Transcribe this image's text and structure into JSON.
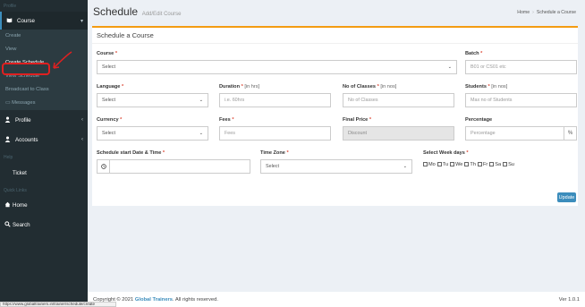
{
  "sidebar": {
    "header_profile": "Profile",
    "course_menu": "Course",
    "course_sub": [
      "Create",
      "View",
      "Create Schedule",
      "View Schedule",
      "Broadcast to Class",
      "Messages"
    ],
    "profile_menu": "Profile",
    "accounts_menu": "Accounts",
    "header_help": "Help",
    "ticket": "Ticket",
    "header_quicklinks": "Quick Links",
    "home": "Home",
    "search": "Search"
  },
  "page": {
    "title": "Schedule",
    "subtitle": "Add/Edit Course",
    "breadcrumb_home": "Home",
    "breadcrumb_current": "Schedule a Course"
  },
  "form": {
    "box_title": "Schedule a Course",
    "course_label": "Course",
    "course_value": "Select",
    "batch_label": "Batch",
    "batch_placeholder": "B01 or CS01 etc",
    "language_label": "Language",
    "language_value": "Select",
    "duration_label": "Duration",
    "duration_hint": "[in hrs]",
    "duration_placeholder": "i.e. 60hrs",
    "classes_label": "No of Classes",
    "classes_hint": "[in nos]",
    "classes_placeholder": "No of Classes",
    "students_label": "Students",
    "students_hint": "[in nos]",
    "students_placeholder": "Max no of Students",
    "currency_label": "Currency",
    "currency_value": "Select",
    "fees_label": "Fees",
    "fees_placeholder": "Fees",
    "final_price_label": "Final Price",
    "final_price_placeholder": "Discount",
    "percentage_label": "Percentage",
    "percentage_placeholder": "Percentage",
    "percentage_addon": "%",
    "start_label": "Schedule start Date & Time",
    "timezone_label": "Time Zone",
    "timezone_value": "Select",
    "weekdays_label": "Select Week days",
    "weekdays": [
      "Mo",
      "Tu",
      "We",
      "Th",
      "Fr",
      "Sa",
      "Su"
    ],
    "update_button": "Update"
  },
  "footer": {
    "copyright_prefix": "Copyright © 2021",
    "brand": "Global Trainers",
    "rights": ". All rights reserved.",
    "version": "Ver 1.0.1"
  },
  "status_url": "https://www.globaltrainers.in/trainer/schedule/create",
  "colors": {
    "sidebar_bg": "#222d32",
    "accent": "#3c8dbc",
    "box_top_border": "#f39c12",
    "highlight": "#e02020"
  }
}
